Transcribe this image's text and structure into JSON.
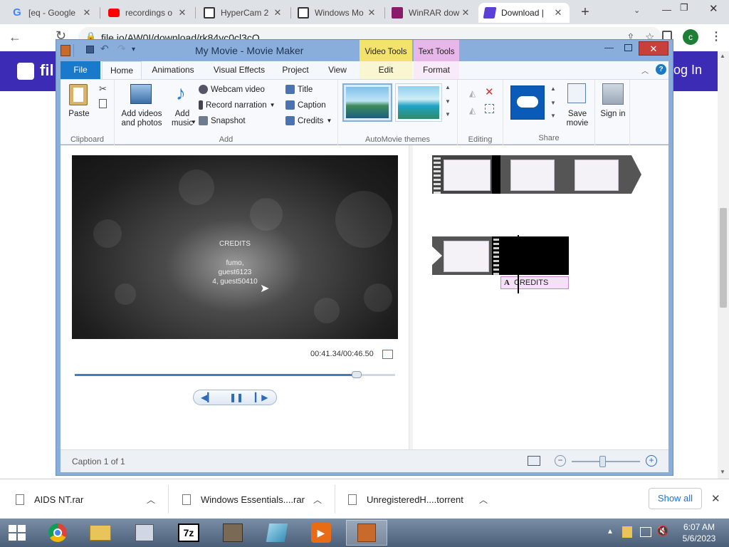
{
  "browser": {
    "tabs": [
      {
        "label": "[eq - Google",
        "icon": "google-icon",
        "color": "#4285f4"
      },
      {
        "label": "recordings o",
        "icon": "youtube-icon",
        "color": "#ff0000"
      },
      {
        "label": "HyperCam 2",
        "icon": "archive-icon",
        "color": "#333333"
      },
      {
        "label": "Windows Mo",
        "icon": "archive-icon",
        "color": "#333333"
      },
      {
        "label": "WinRAR dow",
        "icon": "winrar-icon",
        "color": "#8b1a6b"
      },
      {
        "label": "Download |",
        "icon": "filelu-icon",
        "color": "#5b3fd6"
      }
    ],
    "new_tab": "+",
    "url": "file.io/AW0I/download/rk84yc0cl3cO",
    "profile_initial": "c",
    "page_partial_left": "fil",
    "page_partial_right": "og In"
  },
  "window": {
    "title": "My Movie - Movie Maker",
    "context_tabs": [
      "Video Tools",
      "Text Tools"
    ],
    "ribbon_tabs": [
      "File",
      "Home",
      "Animations",
      "Visual Effects",
      "Project",
      "View",
      "Edit",
      "Format"
    ]
  },
  "ribbon": {
    "clipboard": {
      "paste": "Paste",
      "label": "Clipboard"
    },
    "add": {
      "add_videos": "Add videos and photos",
      "add_music": "Add music",
      "webcam": "Webcam video",
      "record": "Record narration",
      "snapshot": "Snapshot",
      "title": "Title",
      "caption": "Caption",
      "credits": "Credits",
      "label": "Add"
    },
    "themes": {
      "label": "AutoMovie themes"
    },
    "editing": {
      "label": "Editing"
    },
    "share": {
      "save_movie": "Save movie",
      "sign_in": "Sign in",
      "label": "Share"
    }
  },
  "preview": {
    "credits_heading": "CREDITS",
    "line1": "fumo,",
    "line2": "guest6123",
    "line3": "4, guest50410",
    "time": "00:41.34/00:46.50",
    "progress": 0.879
  },
  "storyboard": {
    "caption_label": "CREDITS"
  },
  "status": {
    "text": "Caption 1 of 1",
    "zoom_level": 0.45
  },
  "downloads": [
    {
      "name": "AIDS NT.rar"
    },
    {
      "name": "Windows Essentials....rar"
    },
    {
      "name": "UnregisteredH....torrent"
    }
  ],
  "downloads_show_all": "Show all",
  "taskbar": {
    "time": "6:07 AM",
    "date": "5/6/2023"
  }
}
